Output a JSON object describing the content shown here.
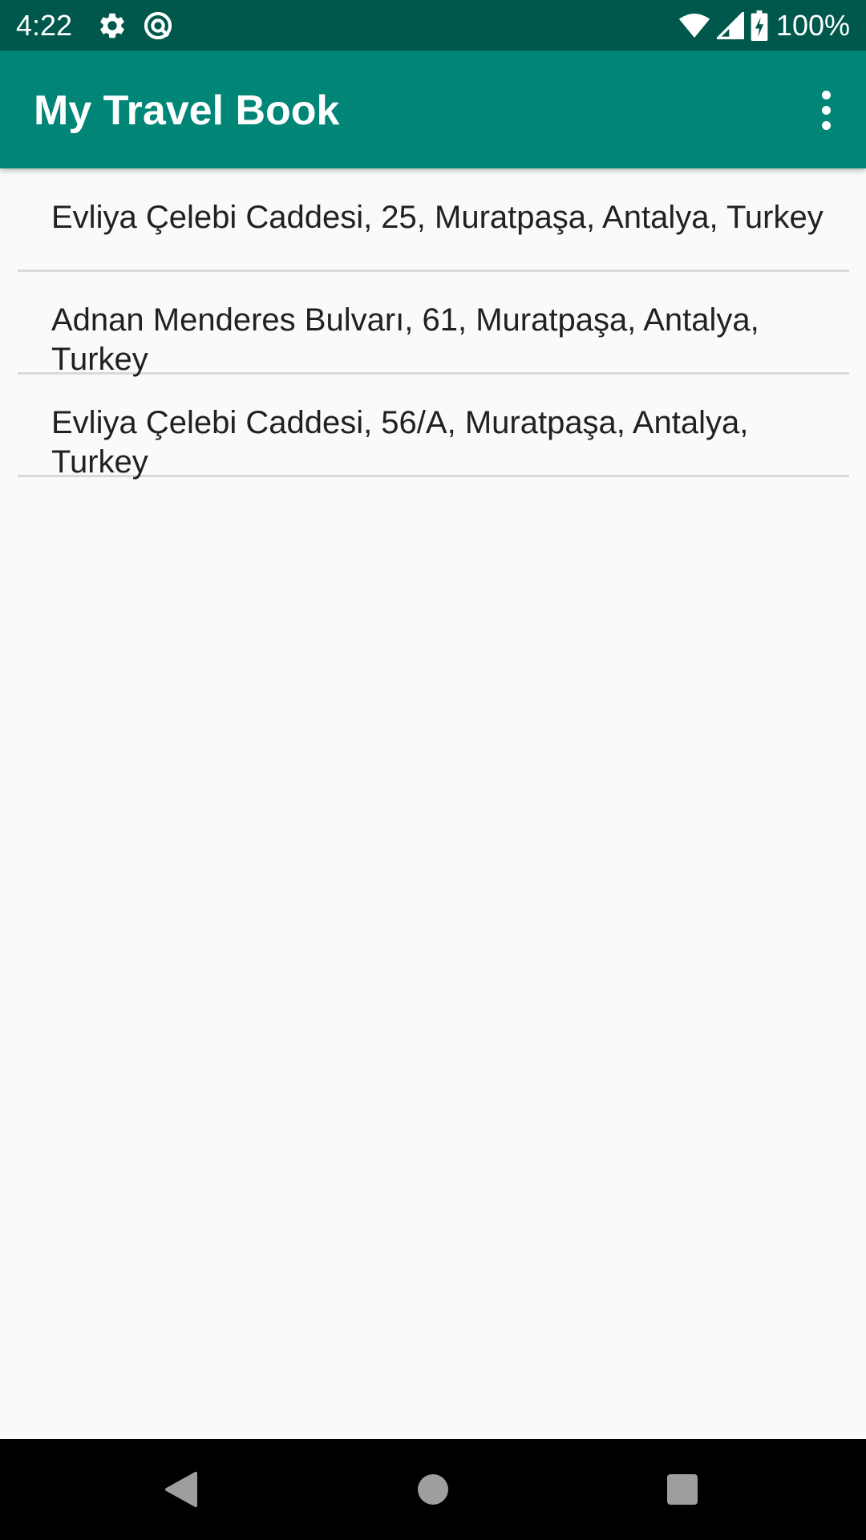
{
  "status_bar": {
    "time": "4:22",
    "battery": "100%",
    "left_icons": [
      "gear-icon",
      "sync-icon"
    ],
    "right_icons": [
      "wifi-icon",
      "signal-icon",
      "battery-charging-icon"
    ],
    "background": "#00574b"
  },
  "app_bar": {
    "title": "My Travel Book",
    "background": "#008577",
    "overflow_icon": "more-vert-icon"
  },
  "places": [
    {
      "address": "Evliya Çelebi Caddesi, 25, Muratpaşa, Antalya, Turkey"
    },
    {
      "address": "Adnan Menderes Bulvarı, 61, Muratpaşa, Antalya, Turkey"
    },
    {
      "address": "Evliya Çelebi Caddesi, 56/A, Muratpaşa, Antalya, Turkey"
    }
  ],
  "nav_bar": {
    "buttons": [
      "back-icon",
      "home-icon",
      "recents-icon"
    ]
  }
}
